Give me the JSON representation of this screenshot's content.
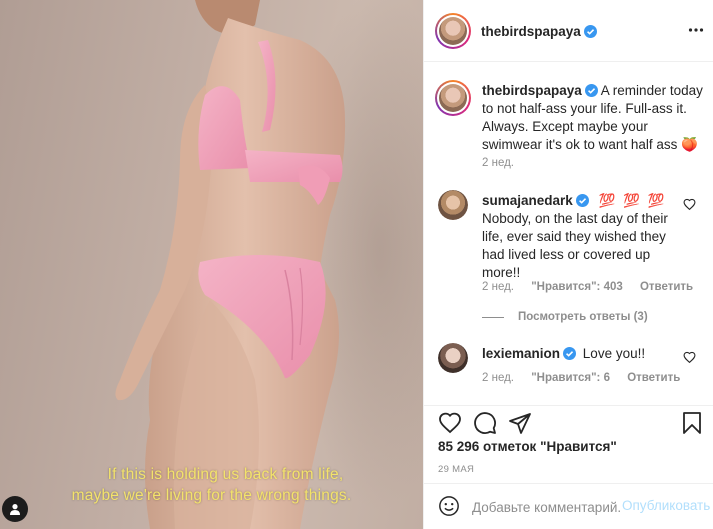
{
  "photo": {
    "caption_line1": "If this is holding us back from life,",
    "caption_line2": "maybe we're living for the wrong things."
  },
  "header": {
    "username": "thebirdspapaya"
  },
  "post_caption": {
    "username": "thebirdspapaya",
    "text": "A reminder today to not half-ass your life. Full-ass it. Always. Except maybe your swimwear it's ok to want half ass 🍑",
    "age": "2 нед."
  },
  "comments": [
    {
      "username": "sumajanedark",
      "emoji": "💯 💯 💯",
      "text": "Nobody, on the last day of their life, ever said they wished they had lived less or covered up more!!",
      "age": "2 нед.",
      "likes": "\"Нравится\": 403",
      "reply": "Ответить",
      "view_replies": "Посмотреть ответы (3)"
    },
    {
      "username": "lexiemanion",
      "text": "Love you!!",
      "age": "2 нед.",
      "likes": "\"Нравится\": 6",
      "reply": "Ответить"
    }
  ],
  "actions": {
    "likes_count": "85 296 отметок \"Нравится\"",
    "date": "29 МАЯ"
  },
  "add_comment": {
    "placeholder": "Добавьте комментарий...",
    "publish": "Опубликовать"
  },
  "colors": {
    "verified": "#3897f0",
    "caption_yellow": "#f3e36b",
    "swimsuit": "#f2a6bd",
    "publish_disabled": "#b2dffc"
  }
}
